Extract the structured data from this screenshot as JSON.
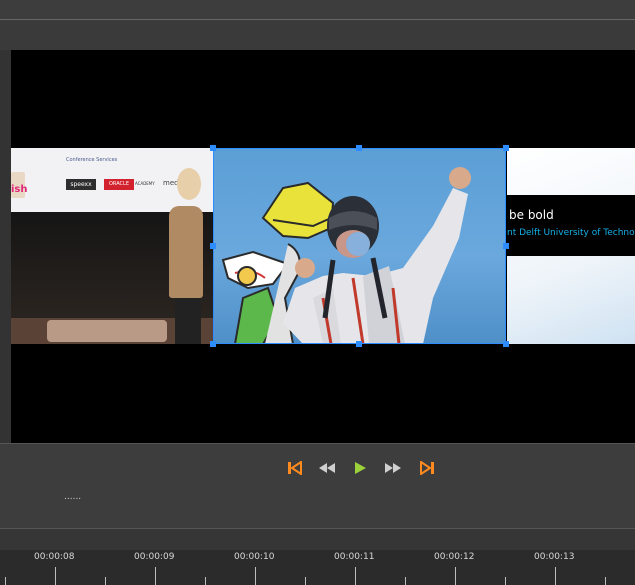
{
  "viewer": {
    "left_clip": {
      "banner_small_text": "Conference Services",
      "logo_1": "speexx",
      "logo_2": "ORACLE",
      "logo_3": "ACADEMY",
      "logo_4": "medi",
      "pink_text": "ish"
    },
    "right_clip": {
      "title": "be bold",
      "subtitle": "nt Delft University of Technology"
    }
  },
  "transport": {
    "buttons": [
      "skip-to-start",
      "rewind",
      "play",
      "fast-forward",
      "skip-to-end"
    ],
    "accent_orange": "#ff8a1f",
    "accent_green": "#9bd23c",
    "status_dots": "......"
  },
  "timeline": {
    "ruler_labels": [
      "00:00:08",
      "00:00:09",
      "00:00:10",
      "00:00:11",
      "00:00:12",
      "00:00:13"
    ]
  },
  "selection_color": "#2d8cff"
}
